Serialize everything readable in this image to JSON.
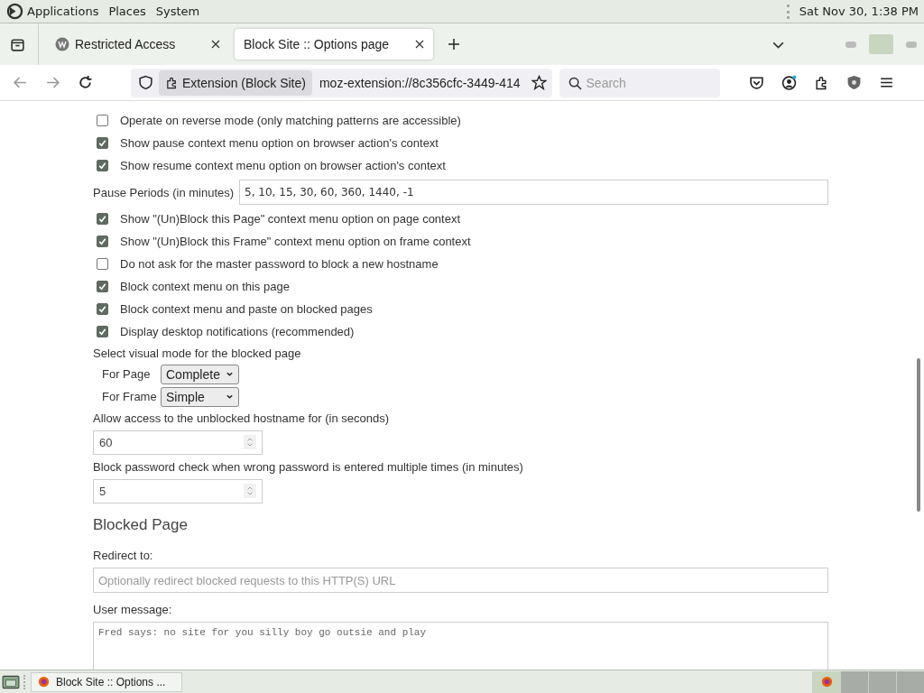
{
  "top_panel": {
    "menus": [
      "Applications",
      "Places",
      "System"
    ],
    "clock": "Sat Nov 30, 1:38 PM"
  },
  "tabs": [
    {
      "label": "Restricted Access",
      "selected": false,
      "favicon": true
    },
    {
      "label": "Block Site :: Options page",
      "selected": true,
      "favicon": false
    }
  ],
  "toolbar": {
    "identity": "Extension (Block Site)",
    "url": "moz-extension://8c356cfc-3449-414",
    "search": {
      "placeholder": "Search"
    }
  },
  "settings": [
    {
      "kind": "checkbox",
      "label": "Operate on reverse mode (only matching patterns are accessible)",
      "checked": false
    },
    {
      "kind": "checkbox",
      "label": "Show pause context menu option on browser action's context",
      "checked": true
    },
    {
      "kind": "checkbox",
      "label": "Show resume context menu option on browser action's context",
      "checked": true
    },
    {
      "kind": "inline-field",
      "label": "Pause Periods (in minutes)",
      "value": "5, 10, 15, 30, 60, 360, 1440, -1"
    },
    {
      "kind": "checkbox",
      "label": "Show \"(Un)Block this Page\" context menu option on page context",
      "checked": true
    },
    {
      "kind": "checkbox",
      "label": "Show \"(Un)Block this Frame\" context menu option on frame context",
      "checked": true
    },
    {
      "kind": "checkbox",
      "label": "Do not ask for the master password to block a new hostname",
      "checked": false
    },
    {
      "kind": "checkbox",
      "label": "Block context menu on this page",
      "checked": true
    },
    {
      "kind": "checkbox",
      "label": "Block context menu and paste on blocked pages",
      "checked": true
    },
    {
      "kind": "checkbox",
      "label": "Display desktop notifications (recommended)",
      "checked": true
    },
    {
      "kind": "label",
      "label": "Select visual mode for the blocked page"
    },
    {
      "kind": "select",
      "label": "For Page",
      "value": "Complete"
    },
    {
      "kind": "select",
      "label": "For Frame",
      "value": "Simple"
    },
    {
      "kind": "label",
      "label": "Allow access to the unblocked hostname for (in seconds)"
    },
    {
      "kind": "number",
      "value": "60"
    },
    {
      "kind": "label",
      "label": "Block password check when wrong password is entered multiple times (in minutes)"
    },
    {
      "kind": "number",
      "value": "5"
    },
    {
      "kind": "heading",
      "label": "Blocked Page"
    },
    {
      "kind": "label",
      "label": "Redirect to:"
    },
    {
      "kind": "field",
      "placeholder": "Optionally redirect blocked requests to this HTTP(S) URL"
    },
    {
      "kind": "label",
      "label": "User message:"
    },
    {
      "kind": "textarea",
      "value": "Fred says: no site for you silly boy go outsie and play"
    }
  ],
  "taskbar": {
    "window": "Block Site :: Options ..."
  }
}
